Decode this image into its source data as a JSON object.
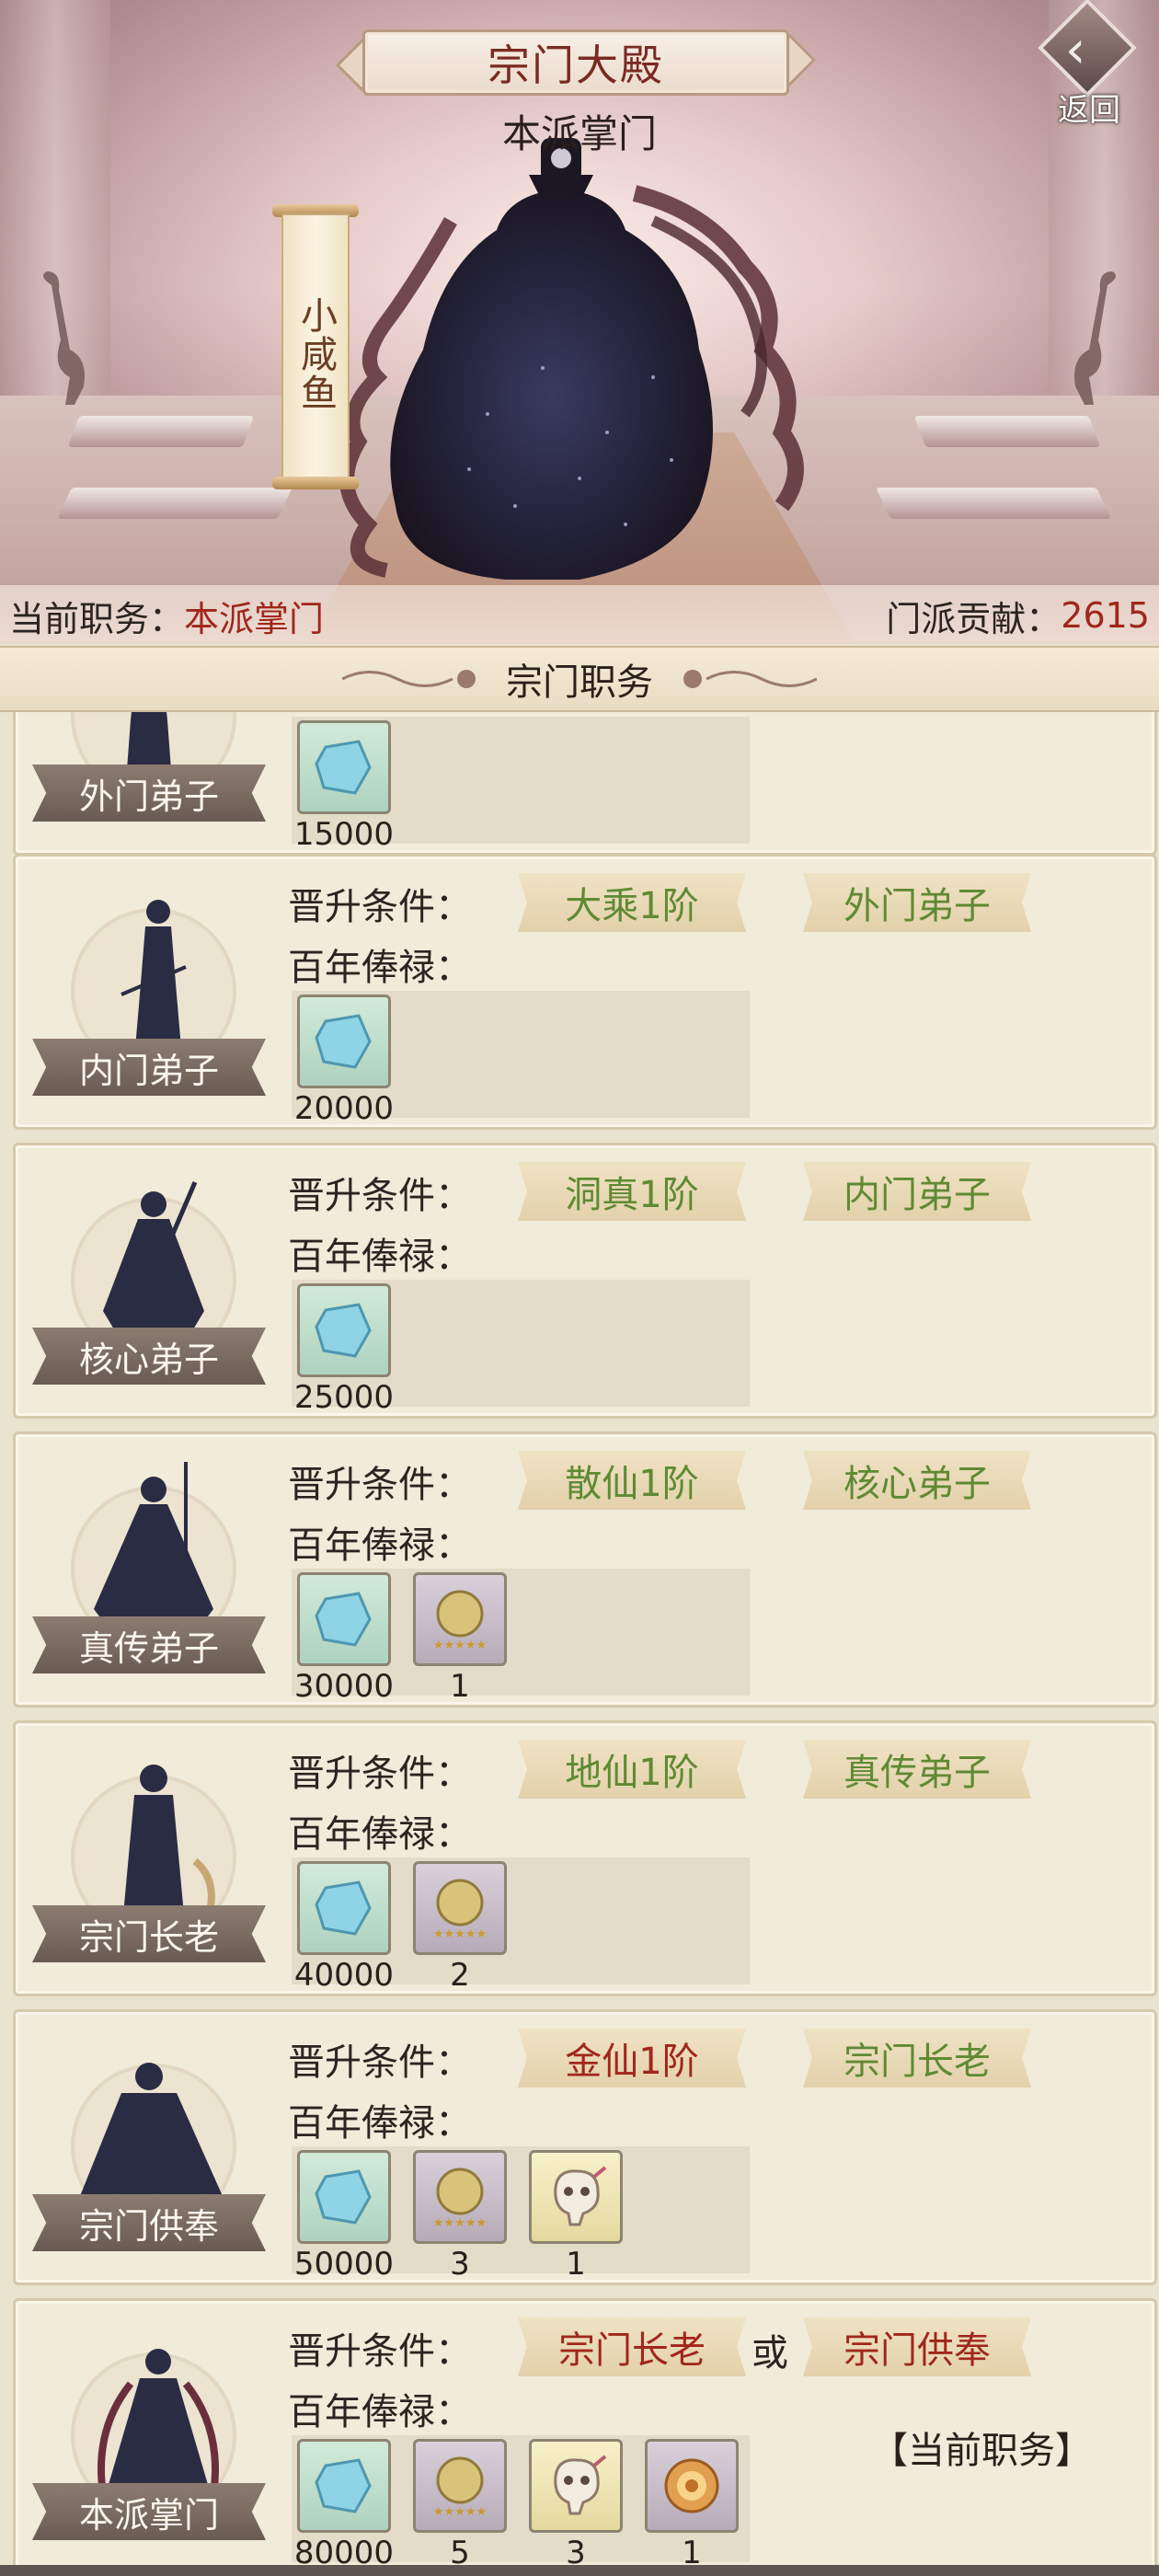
{
  "header": {
    "title": "宗门大殿",
    "back_label": "返回",
    "master_label": "本派掌门",
    "master_name": "小咸鱼"
  },
  "status": {
    "position_label": "当前职务：",
    "position_value": "本派掌门",
    "contribution_label": "门派贡献：",
    "contribution_value": "2615"
  },
  "section_title": "宗门职务",
  "labels": {
    "condition": "晋升条件：",
    "salary": "百年俸禄：",
    "or": "或",
    "current": "【当前职务】"
  },
  "ranks": [
    {
      "name": "外门弟子",
      "rewards": [
        {
          "icon": "spirit-stone",
          "qty": "15000"
        }
      ]
    },
    {
      "name": "内门弟子",
      "conditions": [
        {
          "text": "大乘1阶",
          "color": "green"
        },
        {
          "text": "外门弟子",
          "color": "green"
        }
      ],
      "rewards": [
        {
          "icon": "spirit-stone",
          "qty": "20000"
        }
      ]
    },
    {
      "name": "核心弟子",
      "conditions": [
        {
          "text": "洞真1阶",
          "color": "green"
        },
        {
          "text": "内门弟子",
          "color": "green"
        }
      ],
      "rewards": [
        {
          "icon": "spirit-stone",
          "qty": "25000"
        }
      ]
    },
    {
      "name": "真传弟子",
      "conditions": [
        {
          "text": "散仙1阶",
          "color": "green"
        },
        {
          "text": "核心弟子",
          "color": "green"
        }
      ],
      "rewards": [
        {
          "icon": "spirit-stone",
          "qty": "30000"
        },
        {
          "icon": "star-pill",
          "qty": "1"
        }
      ]
    },
    {
      "name": "宗门长老",
      "conditions": [
        {
          "text": "地仙1阶",
          "color": "green"
        },
        {
          "text": "真传弟子",
          "color": "green"
        }
      ],
      "rewards": [
        {
          "icon": "spirit-stone",
          "qty": "40000"
        },
        {
          "icon": "star-pill",
          "qty": "2"
        }
      ]
    },
    {
      "name": "宗门供奉",
      "conditions": [
        {
          "text": "金仙1阶",
          "color": "red"
        },
        {
          "text": "宗门长老",
          "color": "green"
        }
      ],
      "rewards": [
        {
          "icon": "spirit-stone",
          "qty": "50000"
        },
        {
          "icon": "star-pill",
          "qty": "3"
        },
        {
          "icon": "beast-skull",
          "qty": "1"
        }
      ]
    },
    {
      "name": "本派掌门",
      "conditions": [
        {
          "text": "宗门长老",
          "color": "red"
        },
        {
          "text": "宗门供奉",
          "color": "red"
        }
      ],
      "rewards": [
        {
          "icon": "spirit-stone",
          "qty": "80000"
        },
        {
          "icon": "star-pill",
          "qty": "5"
        },
        {
          "icon": "beast-skull",
          "qty": "3"
        },
        {
          "icon": "golden-orb",
          "qty": "1"
        }
      ]
    }
  ]
}
